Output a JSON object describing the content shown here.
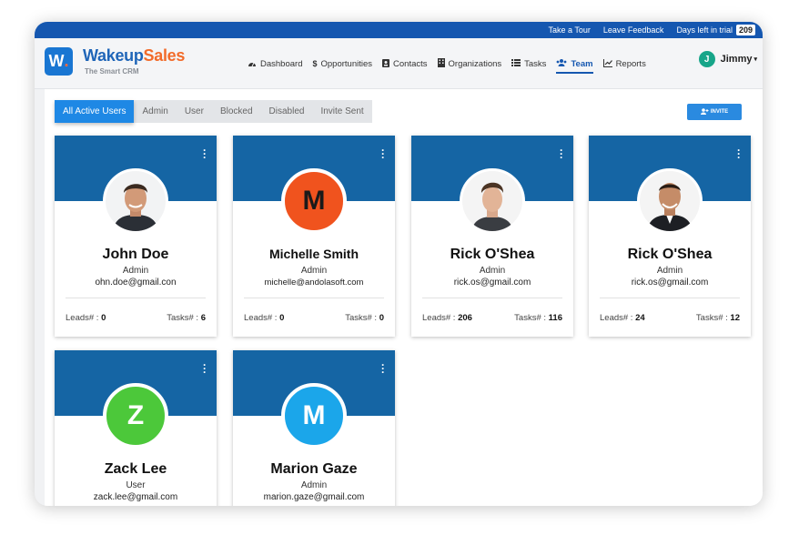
{
  "topbar": {
    "take_tour": "Take a Tour",
    "leave_feedback": "Leave Feedback",
    "trial_label": "Days left in trial",
    "trial_days": "209"
  },
  "brand": {
    "logo_letter": "W",
    "logo_dot": ".",
    "name_part1": "Wakeup",
    "name_part2": "Sales",
    "tagline": "The Smart CRM"
  },
  "nav": [
    {
      "label": "Dashboard",
      "icon": "dashboard-icon"
    },
    {
      "label": "Opportunities",
      "icon": "dollar-icon"
    },
    {
      "label": "Contacts",
      "icon": "contact-card-icon"
    },
    {
      "label": "Organizations",
      "icon": "building-icon"
    },
    {
      "label": "Tasks",
      "icon": "list-icon"
    },
    {
      "label": "Team",
      "icon": "team-icon",
      "active": true
    },
    {
      "label": "Reports",
      "icon": "chart-line-icon"
    }
  ],
  "user": {
    "initial": "J",
    "name": "Jimmy"
  },
  "filters": [
    "All Active Users",
    "Admin",
    "User",
    "Blocked",
    "Disabled",
    "Invite Sent"
  ],
  "invite_label": "INVITE",
  "cards": [
    {
      "name": "John Doe",
      "role": "Admin",
      "email": "ohn.doe@gmail.con",
      "leads_label": "Leads# :",
      "leads": "0",
      "tasks_label": "Tasks# :",
      "tasks": "6"
    },
    {
      "name": "Michelle Smith",
      "role": "Admin",
      "email": "michelle@andolasoft.com",
      "initial": "M",
      "leads_label": "Leads# :",
      "leads": "0",
      "tasks_label": "Tasks# :",
      "tasks": "0"
    },
    {
      "name": "Rick O'Shea",
      "role": "Admin",
      "email": "rick.os@gmail.com",
      "leads_label": "Leads# :",
      "leads": "206",
      "tasks_label": "Tasks# :",
      "tasks": "116"
    },
    {
      "name": "Rick O'Shea",
      "role": "Admin",
      "email": "rick.os@gmail.com",
      "leads_label": "Leads# :",
      "leads": "24",
      "tasks_label": "Tasks# :",
      "tasks": "12"
    },
    {
      "name": "Zack Lee",
      "role": "User",
      "email": "zack.lee@gmail.com",
      "initial": "Z"
    },
    {
      "name": "Marion Gaze",
      "role": "Admin",
      "email": "marion.gaze@gmail.com",
      "initial": "M"
    }
  ],
  "colors": {
    "topbar": "#1557b0",
    "card_band": "#1565a4",
    "avatar_michelle": "#f0531e",
    "avatar_zack": "#4cc83a",
    "avatar_marion": "#1ba6ea"
  }
}
